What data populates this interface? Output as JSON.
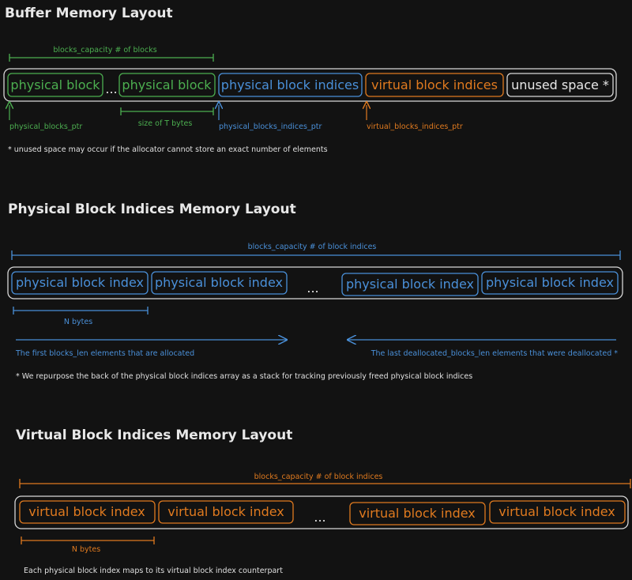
{
  "colors": {
    "background": "#121212",
    "green": "#4caf50",
    "blue": "#4a90d9",
    "orange": "#e07a1f",
    "white": "#e8e8e8"
  },
  "buffer": {
    "title": "Buffer Memory Layout",
    "capacity_label": "blocks_capacity # of blocks",
    "blocks": [
      "physical block",
      "...",
      "physical block",
      "physical block indices",
      "virtual block indices",
      "unused space *"
    ],
    "size_label": "size of T bytes",
    "pointers": [
      "physical_blocks_ptr",
      "physical_blocks_indices_ptr",
      "virtual_blocks_indices_ptr"
    ],
    "note": "* unused space may occur if the allocator cannot store an exact number of elements"
  },
  "physical": {
    "title": "Physical Block Indices Memory Layout",
    "capacity_label": "blocks_capacity # of block indices",
    "cells": [
      "physical block index",
      "physical block index",
      "...",
      "physical block index",
      "physical block index"
    ],
    "n_bytes": "N bytes",
    "left_arrow_label": "The first blocks_len elements that are allocated",
    "right_arrow_label": "The last deallocated_blocks_len elements that were deallocated *",
    "note": "* We repurpose the back of the physical block indices array as a stack for tracking previously freed physical block indices"
  },
  "virtual": {
    "title": "Virtual Block Indices Memory Layout",
    "capacity_label": "blocks_capacity # of block indices",
    "cells": [
      "virtual block index",
      "virtual block index",
      "...",
      "virtual block index",
      "virtual block index"
    ],
    "n_bytes": "N bytes",
    "note": "Each physical block index maps to its virtual block index counterpart"
  }
}
